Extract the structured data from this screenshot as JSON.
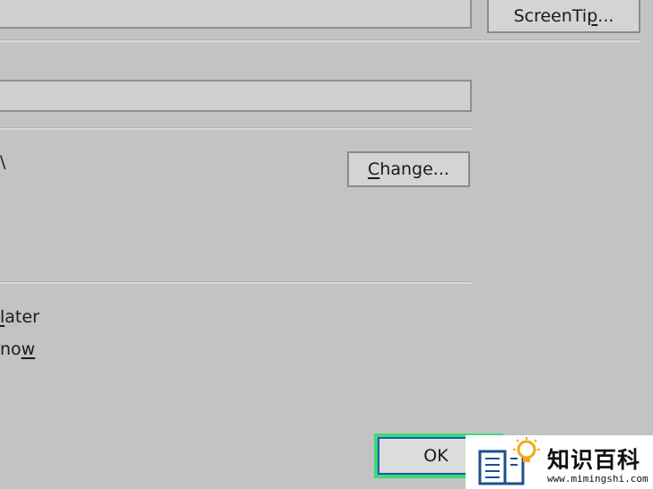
{
  "buttons": {
    "screentip": {
      "pre": "ScreenTi",
      "accel": "p",
      "post": "..."
    },
    "change": {
      "pre": "",
      "accel": "C",
      "post": "hange..."
    },
    "ok": "OK"
  },
  "fields": {
    "text_to_display": "",
    "address": ""
  },
  "path_fragment": "\\",
  "edit_options": {
    "later": {
      "pre": "",
      "accel": "l",
      "post": "ater"
    },
    "now": {
      "pre": "no",
      "accel": "w",
      "post": ""
    }
  },
  "watermark": {
    "title": "知识百科",
    "url": "www.mimingshi.com"
  },
  "colors": {
    "dialog_bg": "#c3c3c3",
    "ok_focus": "#3cd97a",
    "ok_border": "#1e5aa8"
  }
}
